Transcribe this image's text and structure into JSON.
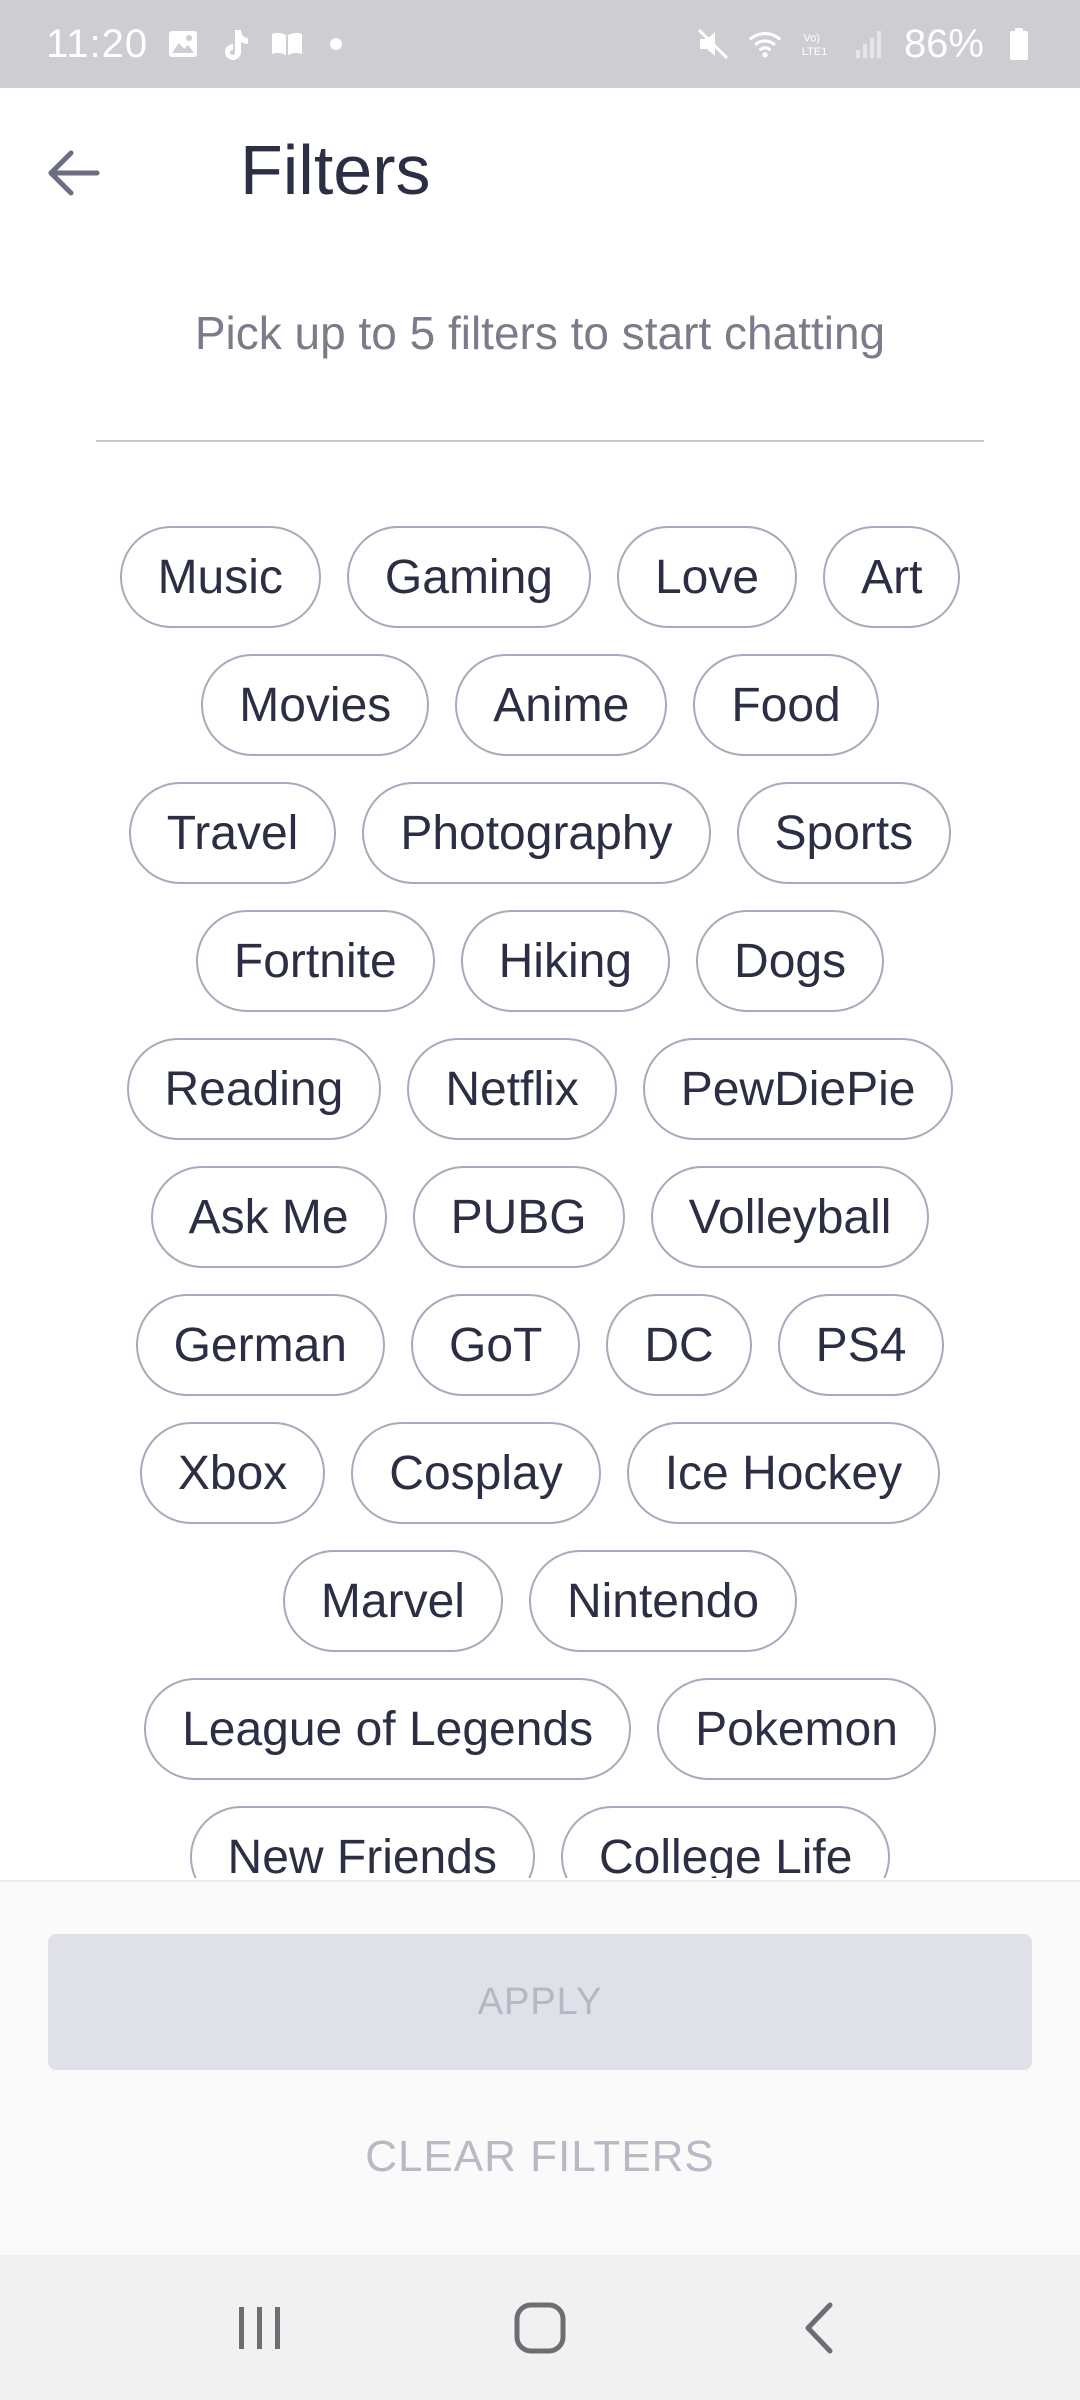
{
  "status_bar": {
    "time": "11:20",
    "battery": "86%",
    "left_icons": [
      "gallery-icon",
      "tiktok-icon",
      "book-icon",
      "dot-icon"
    ],
    "right_icons": [
      "mute-icon",
      "wifi-icon",
      "volte-icon",
      "signal-icon",
      "battery-icon"
    ]
  },
  "header": {
    "back_icon": "arrow-left-icon",
    "title": "Filters"
  },
  "subtitle": "Pick up to 5 filters to start chatting",
  "filter_rows": [
    [
      "Music",
      "Gaming",
      "Love",
      "Art"
    ],
    [
      "Movies",
      "Anime",
      "Food"
    ],
    [
      "Travel",
      "Photography",
      "Sports"
    ],
    [
      "Fortnite",
      "Hiking",
      "Dogs"
    ],
    [
      "Reading",
      "Netflix",
      "PewDiePie"
    ],
    [
      "Ask Me",
      "PUBG",
      "Volleyball"
    ],
    [
      "German",
      "GoT",
      "DC",
      "PS4"
    ],
    [
      "Xbox",
      "Cosplay",
      "Ice Hockey"
    ],
    [
      "Marvel",
      "Nintendo"
    ],
    [
      "League of Legends",
      "Pokemon"
    ],
    [
      "New Friends",
      "College Life"
    ]
  ],
  "actions": {
    "apply_label": "APPLY",
    "clear_label": "CLEAR FILTERS"
  },
  "nav": {
    "icons": [
      "recent-apps-icon",
      "home-icon",
      "back-icon"
    ]
  },
  "colors": {
    "chip_border": "#a9a8bd",
    "text_primary": "#2c2f44",
    "disabled_button": "#e0e0e8",
    "status_bar": "#cdcdd2"
  }
}
